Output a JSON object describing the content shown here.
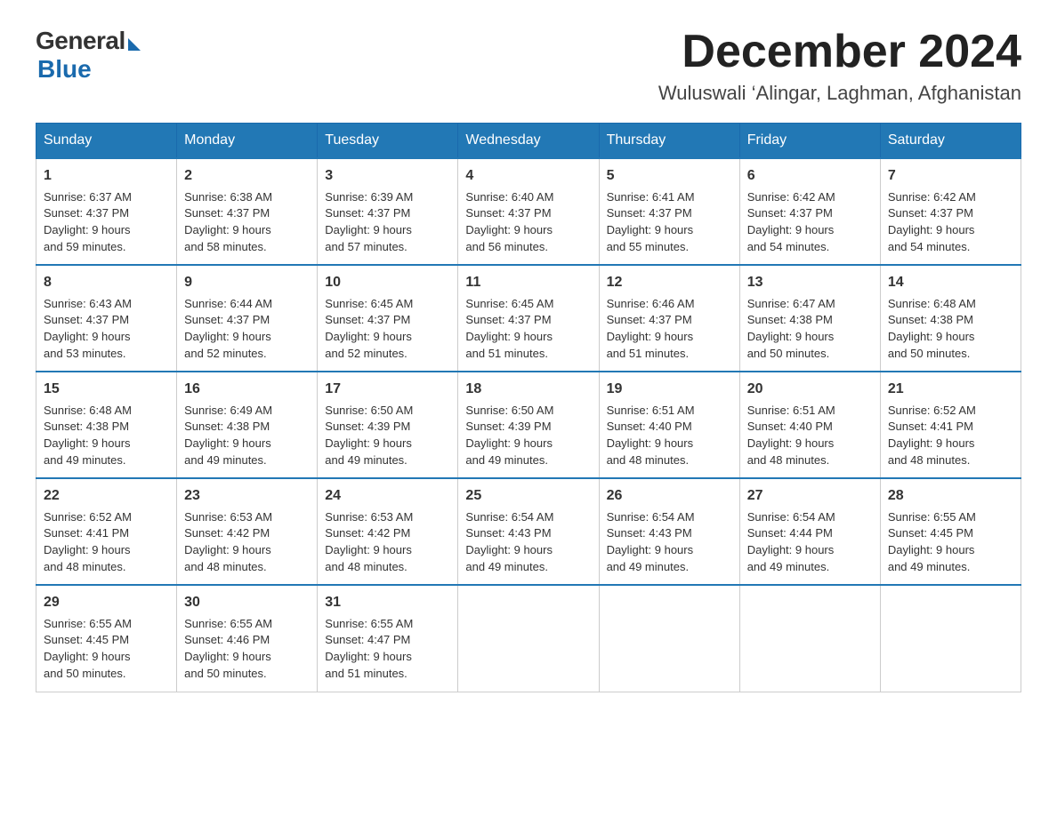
{
  "logo": {
    "general": "General",
    "blue": "Blue"
  },
  "title": "December 2024",
  "location": "Wuluswali ‘Alingar, Laghman, Afghanistan",
  "weekdays": [
    "Sunday",
    "Monday",
    "Tuesday",
    "Wednesday",
    "Thursday",
    "Friday",
    "Saturday"
  ],
  "weeks": [
    [
      {
        "day": "1",
        "sunrise": "6:37 AM",
        "sunset": "4:37 PM",
        "daylight": "9 hours and 59 minutes."
      },
      {
        "day": "2",
        "sunrise": "6:38 AM",
        "sunset": "4:37 PM",
        "daylight": "9 hours and 58 minutes."
      },
      {
        "day": "3",
        "sunrise": "6:39 AM",
        "sunset": "4:37 PM",
        "daylight": "9 hours and 57 minutes."
      },
      {
        "day": "4",
        "sunrise": "6:40 AM",
        "sunset": "4:37 PM",
        "daylight": "9 hours and 56 minutes."
      },
      {
        "day": "5",
        "sunrise": "6:41 AM",
        "sunset": "4:37 PM",
        "daylight": "9 hours and 55 minutes."
      },
      {
        "day": "6",
        "sunrise": "6:42 AM",
        "sunset": "4:37 PM",
        "daylight": "9 hours and 54 minutes."
      },
      {
        "day": "7",
        "sunrise": "6:42 AM",
        "sunset": "4:37 PM",
        "daylight": "9 hours and 54 minutes."
      }
    ],
    [
      {
        "day": "8",
        "sunrise": "6:43 AM",
        "sunset": "4:37 PM",
        "daylight": "9 hours and 53 minutes."
      },
      {
        "day": "9",
        "sunrise": "6:44 AM",
        "sunset": "4:37 PM",
        "daylight": "9 hours and 52 minutes."
      },
      {
        "day": "10",
        "sunrise": "6:45 AM",
        "sunset": "4:37 PM",
        "daylight": "9 hours and 52 minutes."
      },
      {
        "day": "11",
        "sunrise": "6:45 AM",
        "sunset": "4:37 PM",
        "daylight": "9 hours and 51 minutes."
      },
      {
        "day": "12",
        "sunrise": "6:46 AM",
        "sunset": "4:37 PM",
        "daylight": "9 hours and 51 minutes."
      },
      {
        "day": "13",
        "sunrise": "6:47 AM",
        "sunset": "4:38 PM",
        "daylight": "9 hours and 50 minutes."
      },
      {
        "day": "14",
        "sunrise": "6:48 AM",
        "sunset": "4:38 PM",
        "daylight": "9 hours and 50 minutes."
      }
    ],
    [
      {
        "day": "15",
        "sunrise": "6:48 AM",
        "sunset": "4:38 PM",
        "daylight": "9 hours and 49 minutes."
      },
      {
        "day": "16",
        "sunrise": "6:49 AM",
        "sunset": "4:38 PM",
        "daylight": "9 hours and 49 minutes."
      },
      {
        "day": "17",
        "sunrise": "6:50 AM",
        "sunset": "4:39 PM",
        "daylight": "9 hours and 49 minutes."
      },
      {
        "day": "18",
        "sunrise": "6:50 AM",
        "sunset": "4:39 PM",
        "daylight": "9 hours and 49 minutes."
      },
      {
        "day": "19",
        "sunrise": "6:51 AM",
        "sunset": "4:40 PM",
        "daylight": "9 hours and 48 minutes."
      },
      {
        "day": "20",
        "sunrise": "6:51 AM",
        "sunset": "4:40 PM",
        "daylight": "9 hours and 48 minutes."
      },
      {
        "day": "21",
        "sunrise": "6:52 AM",
        "sunset": "4:41 PM",
        "daylight": "9 hours and 48 minutes."
      }
    ],
    [
      {
        "day": "22",
        "sunrise": "6:52 AM",
        "sunset": "4:41 PM",
        "daylight": "9 hours and 48 minutes."
      },
      {
        "day": "23",
        "sunrise": "6:53 AM",
        "sunset": "4:42 PM",
        "daylight": "9 hours and 48 minutes."
      },
      {
        "day": "24",
        "sunrise": "6:53 AM",
        "sunset": "4:42 PM",
        "daylight": "9 hours and 48 minutes."
      },
      {
        "day": "25",
        "sunrise": "6:54 AM",
        "sunset": "4:43 PM",
        "daylight": "9 hours and 49 minutes."
      },
      {
        "day": "26",
        "sunrise": "6:54 AM",
        "sunset": "4:43 PM",
        "daylight": "9 hours and 49 minutes."
      },
      {
        "day": "27",
        "sunrise": "6:54 AM",
        "sunset": "4:44 PM",
        "daylight": "9 hours and 49 minutes."
      },
      {
        "day": "28",
        "sunrise": "6:55 AM",
        "sunset": "4:45 PM",
        "daylight": "9 hours and 49 minutes."
      }
    ],
    [
      {
        "day": "29",
        "sunrise": "6:55 AM",
        "sunset": "4:45 PM",
        "daylight": "9 hours and 50 minutes."
      },
      {
        "day": "30",
        "sunrise": "6:55 AM",
        "sunset": "4:46 PM",
        "daylight": "9 hours and 50 minutes."
      },
      {
        "day": "31",
        "sunrise": "6:55 AM",
        "sunset": "4:47 PM",
        "daylight": "9 hours and 51 minutes."
      },
      null,
      null,
      null,
      null
    ]
  ],
  "labels": {
    "sunrise": "Sunrise:",
    "sunset": "Sunset:",
    "daylight": "Daylight:"
  }
}
